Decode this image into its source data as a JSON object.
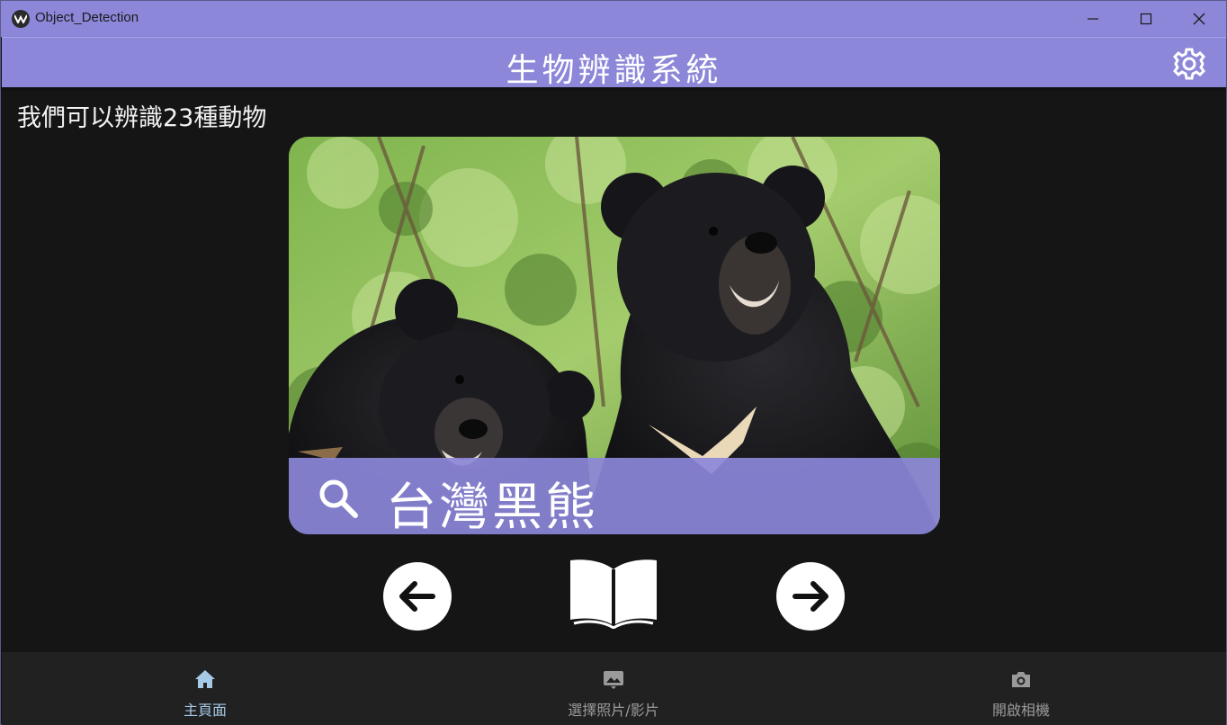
{
  "window": {
    "title": "Object_Detection"
  },
  "appbar": {
    "title": "生物辨識系統",
    "settings_icon": "gear-icon"
  },
  "main": {
    "subtitle": "我們可以辨識23種動物",
    "result": {
      "name": "台灣黑熊",
      "icon": "search-icon"
    },
    "controls": {
      "prev_icon": "arrow-left-icon",
      "book_icon": "open-book-icon",
      "next_icon": "arrow-right-icon"
    }
  },
  "bottom_nav": {
    "items": [
      {
        "label": "主頁面",
        "icon": "home-icon",
        "active": true
      },
      {
        "label": "選擇照片/影片",
        "icon": "image-icon",
        "active": false
      },
      {
        "label": "開啟相機",
        "icon": "camera-icon",
        "active": false
      }
    ]
  },
  "colors": {
    "accent": "#8c87d9",
    "background": "#151515",
    "nav_background": "#212121",
    "active_nav": "#a7c9e8"
  }
}
